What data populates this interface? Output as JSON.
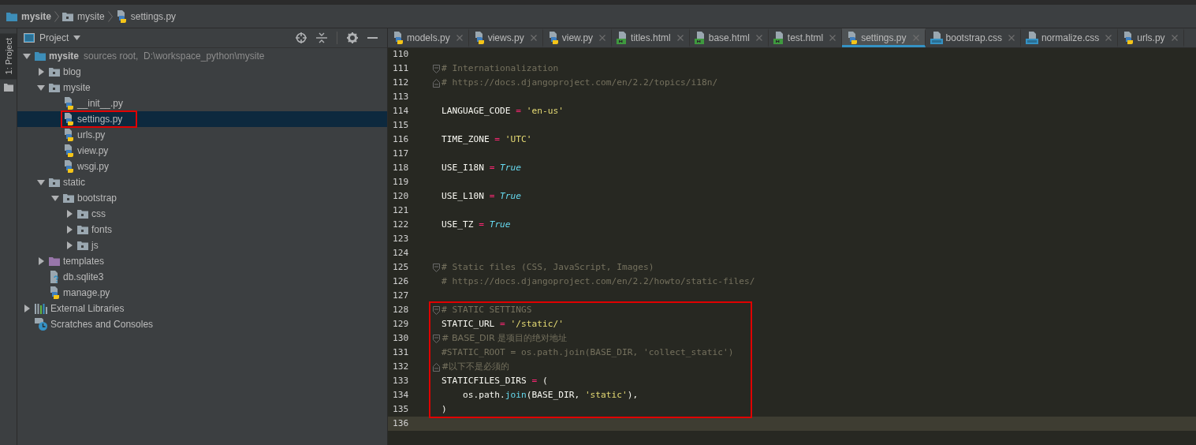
{
  "breadcrumbs": [
    {
      "label": "mysite",
      "kind": "root-folder"
    },
    {
      "label": "mysite",
      "kind": "package"
    },
    {
      "label": "settings.py",
      "kind": "python"
    }
  ],
  "tool_strip": {
    "label": "1: Project",
    "selected": true
  },
  "project": {
    "title": "Project",
    "tree": [
      {
        "label": "mysite",
        "kind": "root-folder",
        "hint": "sources root,  D:\\workspace_python\\mysite",
        "expanded": true,
        "selected": false,
        "annotated": false,
        "children": [
          {
            "label": "blog",
            "kind": "package",
            "expanded": false,
            "selected": false,
            "annotated": false
          },
          {
            "label": "mysite",
            "kind": "package",
            "expanded": true,
            "selected": false,
            "annotated": false,
            "children": [
              {
                "label": "__init__.py",
                "kind": "python",
                "selected": false,
                "annotated": false
              },
              {
                "label": "settings.py",
                "kind": "python",
                "selected": true,
                "annotated": true
              },
              {
                "label": "urls.py",
                "kind": "python",
                "selected": false,
                "annotated": false
              },
              {
                "label": "view.py",
                "kind": "python",
                "selected": false,
                "annotated": false
              },
              {
                "label": "wsgi.py",
                "kind": "python",
                "selected": false,
                "annotated": false
              }
            ]
          },
          {
            "label": "static",
            "kind": "package",
            "expanded": true,
            "selected": false,
            "annotated": false,
            "children": [
              {
                "label": "bootstrap",
                "kind": "package",
                "expanded": true,
                "selected": false,
                "annotated": false,
                "children": [
                  {
                    "label": "css",
                    "kind": "package",
                    "expanded": false,
                    "selected": false,
                    "annotated": false
                  },
                  {
                    "label": "fonts",
                    "kind": "package",
                    "expanded": false,
                    "selected": false,
                    "annotated": false
                  },
                  {
                    "label": "js",
                    "kind": "package",
                    "expanded": false,
                    "selected": false,
                    "annotated": false
                  }
                ]
              }
            ]
          },
          {
            "label": "templates",
            "kind": "templates-folder",
            "expanded": false,
            "selected": false,
            "annotated": false
          },
          {
            "label": "db.sqlite3",
            "kind": "sqlite",
            "selected": false,
            "annotated": false
          },
          {
            "label": "manage.py",
            "kind": "python",
            "selected": false,
            "annotated": false
          }
        ]
      },
      {
        "label": "External Libraries",
        "kind": "libraries",
        "expanded": false,
        "selected": false,
        "annotated": false
      },
      {
        "label": "Scratches and Consoles",
        "kind": "scratches",
        "selected": false,
        "annotated": false
      }
    ]
  },
  "editor": {
    "tabs": [
      {
        "label": "models.py",
        "kind": "python",
        "selected": false
      },
      {
        "label": "views.py",
        "kind": "python",
        "selected": false
      },
      {
        "label": "view.py",
        "kind": "python",
        "selected": false
      },
      {
        "label": "titles.html",
        "kind": "html",
        "selected": false
      },
      {
        "label": "base.html",
        "kind": "html",
        "selected": false
      },
      {
        "label": "test.html",
        "kind": "html",
        "selected": false
      },
      {
        "label": "settings.py",
        "kind": "python",
        "selected": true
      },
      {
        "label": "bootstrap.css",
        "kind": "css",
        "selected": false
      },
      {
        "label": "normalize.css",
        "kind": "css",
        "selected": false
      },
      {
        "label": "urls.py",
        "kind": "python",
        "selected": false
      }
    ],
    "lines": [
      {
        "kind": "line",
        "number": "110",
        "current": false,
        "fold_start": false,
        "fold_end": false
      },
      {
        "kind": "line",
        "number": "111",
        "current": false,
        "fold_start": true,
        "fold_end": false,
        "tokens": [
          {
            "kind": "comment",
            "text": "# Internationalization"
          }
        ]
      },
      {
        "kind": "line",
        "number": "112",
        "current": false,
        "fold_start": false,
        "fold_end": true,
        "tokens": [
          {
            "kind": "comment",
            "text": "# https://docs.djangoproject.com/en/2.2/topics/i18n/"
          }
        ]
      },
      {
        "kind": "line",
        "number": "113",
        "current": false,
        "fold_start": false,
        "fold_end": false
      },
      {
        "kind": "line",
        "number": "114",
        "current": false,
        "fold_start": false,
        "fold_end": false,
        "tokens": [
          {
            "kind": "plain",
            "text": "LANGUAGE_CODE "
          },
          {
            "kind": "operator",
            "text": "="
          },
          {
            "kind": "string",
            "text": " 'en-us'"
          }
        ]
      },
      {
        "kind": "line",
        "number": "115",
        "current": false,
        "fold_start": false,
        "fold_end": false
      },
      {
        "kind": "line",
        "number": "116",
        "current": false,
        "fold_start": false,
        "fold_end": false,
        "tokens": [
          {
            "kind": "plain",
            "text": "TIME_ZONE "
          },
          {
            "kind": "operator",
            "text": "="
          },
          {
            "kind": "string",
            "text": " 'UTC'"
          }
        ]
      },
      {
        "kind": "line",
        "number": "117",
        "current": false,
        "fold_start": false,
        "fold_end": false
      },
      {
        "kind": "line",
        "number": "118",
        "current": false,
        "fold_start": false,
        "fold_end": false,
        "tokens": [
          {
            "kind": "plain",
            "text": "USE_I18N "
          },
          {
            "kind": "operator",
            "text": "="
          },
          {
            "kind": "constant",
            "text": " True"
          }
        ]
      },
      {
        "kind": "line",
        "number": "119",
        "current": false,
        "fold_start": false,
        "fold_end": false
      },
      {
        "kind": "line",
        "number": "120",
        "current": false,
        "fold_start": false,
        "fold_end": false,
        "tokens": [
          {
            "kind": "plain",
            "text": "USE_L10N "
          },
          {
            "kind": "operator",
            "text": "="
          },
          {
            "kind": "constant",
            "text": " True"
          }
        ]
      },
      {
        "kind": "line",
        "number": "121",
        "current": false,
        "fold_start": false,
        "fold_end": false
      },
      {
        "kind": "line",
        "number": "122",
        "current": false,
        "fold_start": false,
        "fold_end": false,
        "tokens": [
          {
            "kind": "plain",
            "text": "USE_TZ "
          },
          {
            "kind": "operator",
            "text": "="
          },
          {
            "kind": "constant",
            "text": " True"
          }
        ]
      },
      {
        "kind": "line",
        "number": "123",
        "current": false,
        "fold_start": false,
        "fold_end": false
      },
      {
        "kind": "line",
        "number": "124",
        "current": false,
        "fold_start": false,
        "fold_end": false
      },
      {
        "kind": "line",
        "number": "125",
        "current": false,
        "fold_start": true,
        "fold_end": false,
        "tokens": [
          {
            "kind": "comment",
            "text": "# Static files (CSS, JavaScript, Images)"
          }
        ]
      },
      {
        "kind": "line",
        "number": "126",
        "current": false,
        "fold_start": false,
        "fold_end": false,
        "tokens": [
          {
            "kind": "comment",
            "text": "# https://docs.djangoproject.com/en/2.2/howto/static-files/"
          }
        ]
      },
      {
        "kind": "line",
        "number": "127",
        "current": false,
        "fold_start": false,
        "fold_end": false
      },
      {
        "kind": "annotation",
        "lines": [
          {
            "kind": "line",
            "number": "128",
            "current": false,
            "fold_start": true,
            "fold_end": false,
            "tokens": [
              {
                "kind": "comment",
                "text": "# STATIC SETTINGS"
              }
            ]
          },
          {
            "kind": "line",
            "number": "129",
            "current": false,
            "fold_start": false,
            "fold_end": false,
            "tokens": [
              {
                "kind": "plain",
                "text": "STATIC_URL "
              },
              {
                "kind": "operator",
                "text": "="
              },
              {
                "kind": "string",
                "text": " '/static/'"
              }
            ]
          },
          {
            "kind": "line",
            "number": "130",
            "current": false,
            "fold_start": true,
            "fold_end": false,
            "tokens": [
              {
                "kind": "comment",
                "text": "# BASE_DIR 是项目的绝对地址"
              }
            ]
          },
          {
            "kind": "line",
            "number": "131",
            "current": false,
            "fold_start": false,
            "fold_end": false,
            "tokens": [
              {
                "kind": "comment",
                "text": "#STATIC_ROOT = os.path.join(BASE_DIR, 'collect_static')"
              }
            ]
          },
          {
            "kind": "line",
            "number": "132",
            "current": false,
            "fold_start": false,
            "fold_end": true,
            "tokens": [
              {
                "kind": "comment",
                "text": "#以下不是必须的"
              }
            ]
          },
          {
            "kind": "line",
            "number": "133",
            "current": false,
            "fold_start": false,
            "fold_end": false,
            "tokens": [
              {
                "kind": "plain",
                "text": "STATICFILES_DIRS "
              },
              {
                "kind": "operator",
                "text": "="
              },
              {
                "kind": "plain",
                "text": " ("
              }
            ]
          },
          {
            "kind": "line",
            "number": "134",
            "current": false,
            "fold_start": false,
            "fold_end": false,
            "tokens": [
              {
                "kind": "plain",
                "text": "    os.path."
              },
              {
                "kind": "builtin",
                "text": "join"
              },
              {
                "kind": "plain",
                "text": "(BASE_DIR, "
              },
              {
                "kind": "string",
                "text": "'static'"
              },
              {
                "kind": "plain",
                "text": "),"
              }
            ]
          },
          {
            "kind": "line",
            "number": "135",
            "current": false,
            "fold_start": false,
            "fold_end": false,
            "tokens": [
              {
                "kind": "plain",
                "text": ")"
              }
            ]
          }
        ]
      },
      {
        "kind": "line",
        "number": "136",
        "current": true,
        "fold_start": false,
        "fold_end": false
      }
    ]
  }
}
